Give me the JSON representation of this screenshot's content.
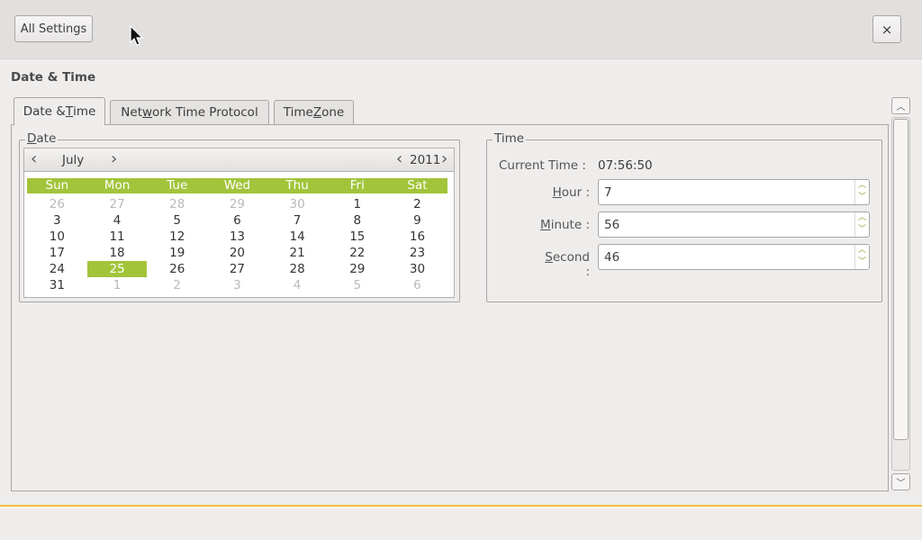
{
  "toolbar": {
    "all_settings_label": "All Settings",
    "close_label": "×"
  },
  "page": {
    "title": "Date & Time"
  },
  "tabs": [
    {
      "label_pre": "Date & ",
      "mnemonic": "T",
      "label_post": "ime",
      "active": true
    },
    {
      "label_pre": "Net",
      "mnemonic": "w",
      "label_post": "ork Time Protocol",
      "active": false
    },
    {
      "label_pre": "Time ",
      "mnemonic": "Z",
      "label_post": "one",
      "active": false
    }
  ],
  "date_frame": {
    "label_mnemonic": "D",
    "label_rest": "ate"
  },
  "calendar": {
    "month": "July",
    "year": "2011",
    "weekdays": [
      "Sun",
      "Mon",
      "Tue",
      "Wed",
      "Thu",
      "Fri",
      "Sat"
    ],
    "weeks": [
      [
        {
          "d": "26",
          "o": true
        },
        {
          "d": "27",
          "o": true
        },
        {
          "d": "28",
          "o": true
        },
        {
          "d": "29",
          "o": true
        },
        {
          "d": "30",
          "o": true
        },
        {
          "d": "1"
        },
        {
          "d": "2"
        }
      ],
      [
        {
          "d": "3"
        },
        {
          "d": "4"
        },
        {
          "d": "5"
        },
        {
          "d": "6"
        },
        {
          "d": "7"
        },
        {
          "d": "8"
        },
        {
          "d": "9"
        }
      ],
      [
        {
          "d": "10"
        },
        {
          "d": "11"
        },
        {
          "d": "12"
        },
        {
          "d": "13"
        },
        {
          "d": "14"
        },
        {
          "d": "15"
        },
        {
          "d": "16"
        }
      ],
      [
        {
          "d": "17"
        },
        {
          "d": "18"
        },
        {
          "d": "19"
        },
        {
          "d": "20"
        },
        {
          "d": "21"
        },
        {
          "d": "22"
        },
        {
          "d": "23"
        }
      ],
      [
        {
          "d": "24"
        },
        {
          "d": "25",
          "sel": true
        },
        {
          "d": "26"
        },
        {
          "d": "27"
        },
        {
          "d": "28"
        },
        {
          "d": "29"
        },
        {
          "d": "30"
        }
      ],
      [
        {
          "d": "31"
        },
        {
          "d": "1",
          "o": true
        },
        {
          "d": "2",
          "o": true
        },
        {
          "d": "3",
          "o": true
        },
        {
          "d": "4",
          "o": true
        },
        {
          "d": "5",
          "o": true
        },
        {
          "d": "6",
          "o": true
        }
      ]
    ],
    "selected_color": "#a2c43a"
  },
  "time_frame": {
    "label": "Time",
    "current_time_label": "Current Time :",
    "current_time_value": "07:56:50",
    "hour": {
      "mnemonic": "H",
      "rest": "our :",
      "value": "7"
    },
    "minute": {
      "mnemonic": "M",
      "rest": "inute :",
      "value": "56"
    },
    "second": {
      "mnemonic": "S",
      "rest": "econd :",
      "value": "46"
    }
  },
  "icons": {
    "prev": "chevron-left-icon",
    "next": "chevron-right-icon",
    "spin_up": "chevron-up-icon",
    "spin_down": "chevron-down-icon"
  }
}
